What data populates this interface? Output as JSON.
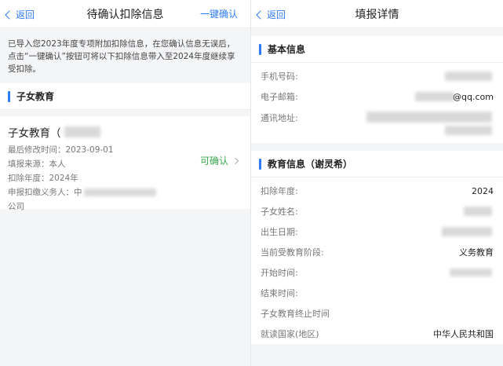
{
  "left": {
    "nav": {
      "back_label": "返回",
      "title": "待确认扣除信息",
      "action_label": "一键确认"
    },
    "notice": "已导入您2023年度专项附加扣除信息，在您确认信息无误后，点击“一键确认”按钮可将以下扣除信息带入至2024年度继续享受扣除。",
    "section_title": "子女教育",
    "card": {
      "title": "子女教育（",
      "rows": [
        {
          "label": "最后修改时间：",
          "value": "2023-09-01"
        },
        {
          "label": "填报来源：",
          "value": "本人"
        },
        {
          "label": "扣除年度：",
          "value": "2024年"
        },
        {
          "label": "申报扣缴义务人：",
          "value": "中"
        }
      ],
      "tail": "公司",
      "status": "可确认"
    }
  },
  "right": {
    "nav": {
      "back_label": "返回",
      "title": "填报详情"
    },
    "basic": {
      "title": "基本信息",
      "phone_label": "手机号码:",
      "email_label": "电子邮箱:",
      "email_tail": "@qq.com",
      "address_label": "通讯地址:"
    },
    "edu": {
      "title": "教育信息（谢灵希）",
      "rows": [
        {
          "label": "扣除年度:",
          "value": "2024"
        },
        {
          "label": "子女姓名:",
          "value": ""
        },
        {
          "label": "出生日期:",
          "value": ""
        },
        {
          "label": "当前受教育阶段:",
          "value": "义务教育"
        },
        {
          "label": "开始时间:",
          "value": ""
        },
        {
          "label": "结束时间:",
          "value": ""
        },
        {
          "label": "子女教育终止时间",
          "value": ""
        },
        {
          "label": "就读国家(地区)",
          "value": "中华人民共和国"
        }
      ]
    }
  }
}
